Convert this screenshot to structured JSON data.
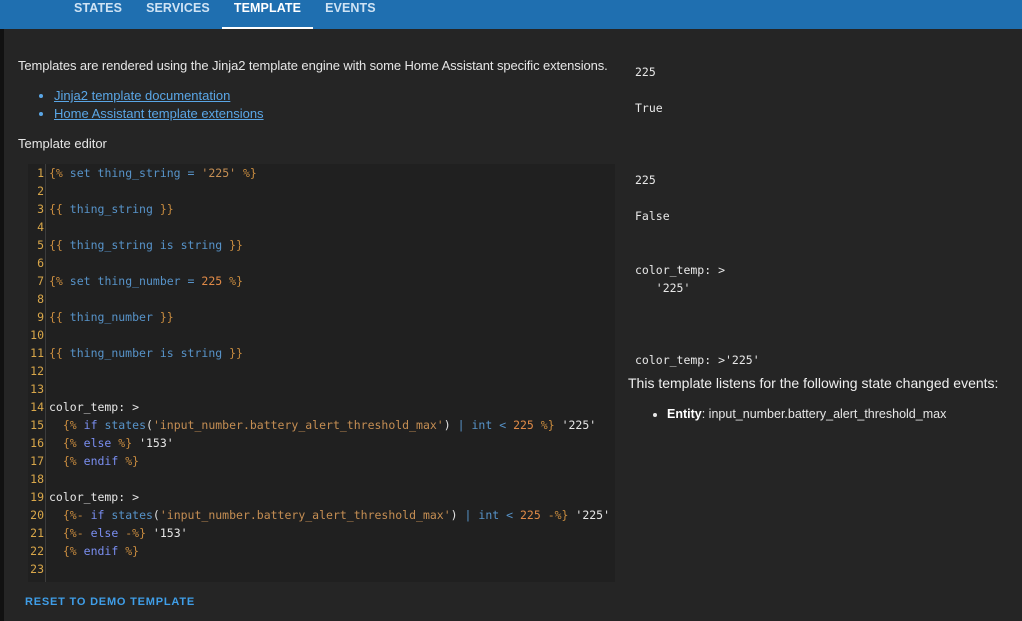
{
  "tabs": [
    {
      "label": "STATES"
    },
    {
      "label": "SERVICES"
    },
    {
      "label": "TEMPLATE",
      "active": true
    },
    {
      "label": "EVENTS"
    }
  ],
  "intro": "Templates are rendered using the Jinja2 template engine with some Home Assistant specific extensions.",
  "links": [
    {
      "label": "Jinja2 template documentation"
    },
    {
      "label": "Home Assistant template extensions"
    }
  ],
  "editor_label": "Template editor",
  "line_numbers": [
    "1",
    "2",
    "3",
    "4",
    "5",
    "6",
    "7",
    "8",
    "9",
    "10",
    "11",
    "12",
    "13",
    "14",
    "15",
    "16",
    "17",
    "18",
    "19",
    "20",
    "21",
    "22",
    "23"
  ],
  "code_lines": [
    "{% set thing_string = '225' %}",
    "",
    "{{ thing_string }}",
    "",
    "{{ thing_string is string }}",
    "",
    "{% set thing_number = 225 %}",
    "",
    "{{ thing_number }}",
    "",
    "{{ thing_number is string }}",
    "",
    "",
    "color_temp: >",
    "  {% if states('input_number.battery_alert_threshold_max') | int < 225 %} '225'",
    "  {% else %} '153'",
    "  {% endif %}",
    "",
    "color_temp: >",
    "  {%- if states('input_number.battery_alert_threshold_max') | int < 225 -%} '225'",
    "  {%- else -%} '153'",
    "  {% endif %}",
    ""
  ],
  "reset_label": "RESET TO DEMO TEMPLATE",
  "output": "225\n\nTrue\n\n\n\n225\n\nFalse\n\n\ncolor_temp: >\n   '225'\n\n\n\ncolor_temp: >'225'",
  "listens_text": "This template listens for the following state changed events:",
  "listener": {
    "type": "Entity",
    "value": ": input_number.battery_alert_threshold_max"
  }
}
